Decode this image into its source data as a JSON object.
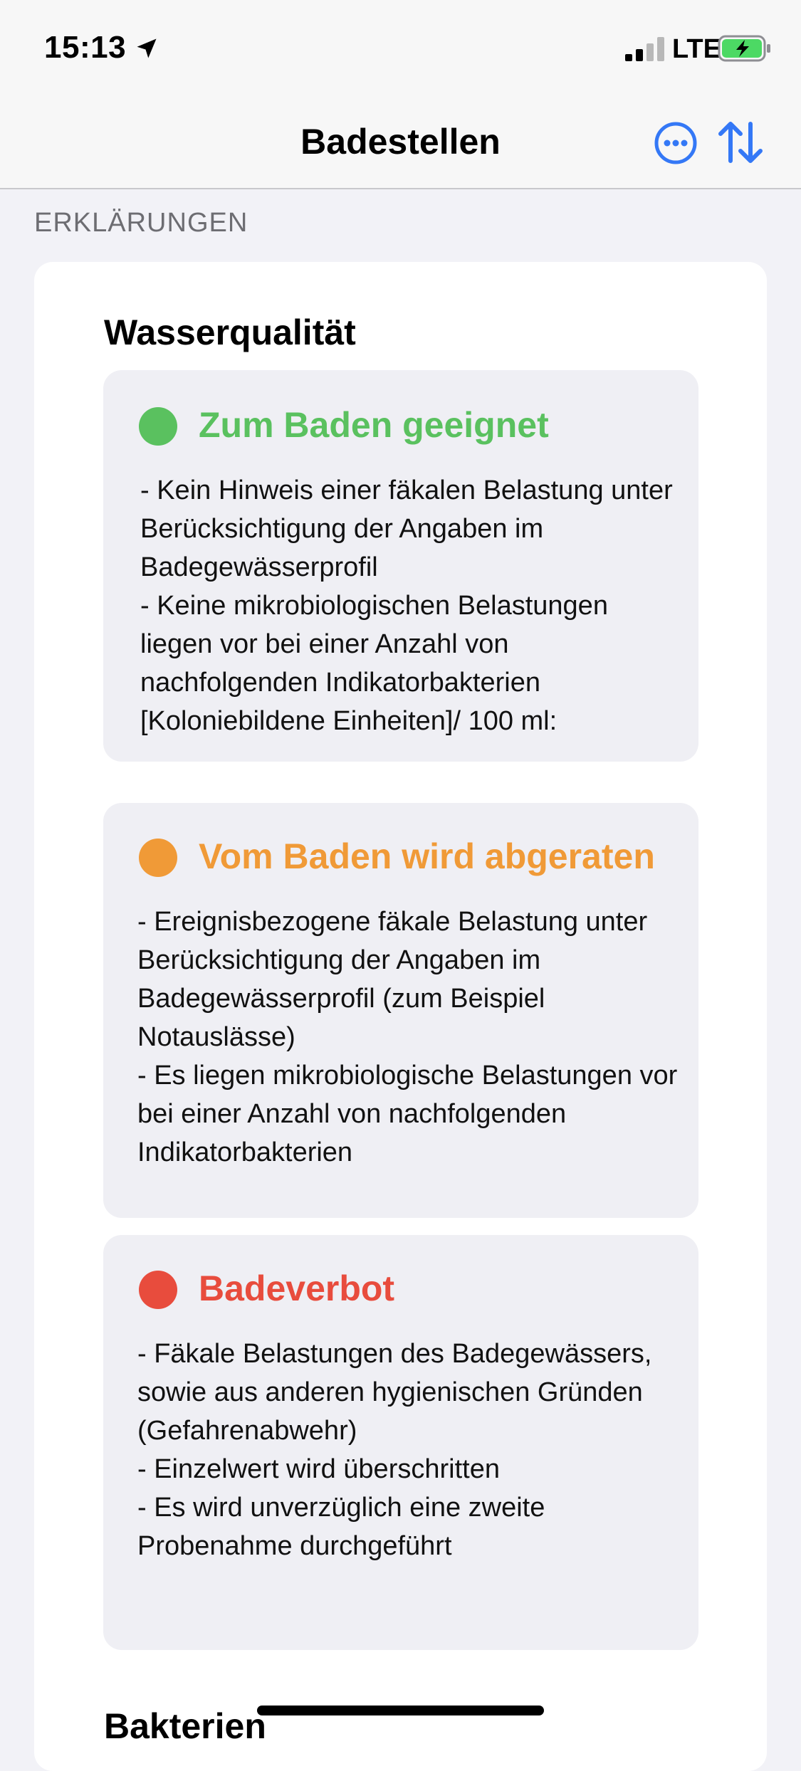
{
  "status_bar": {
    "time": "15:13",
    "network": "LTE",
    "icons": [
      "location-arrow-icon",
      "cellular-signal-icon",
      "battery-charging-icon"
    ]
  },
  "nav": {
    "title": "Badestellen",
    "more_icon": "ellipsis-circle-icon",
    "sort_icon": "sort-arrows-icon"
  },
  "section_header": "ERKLÄRUNGEN",
  "water_quality": {
    "title": "Wasserqualität",
    "items": [
      {
        "title": "Zum Baden geeignet",
        "color": "#5ac15f",
        "text": "- Kein Hinweis einer fäkalen Belastung unter Berücksichtigung der Angaben im Badegewässerprofil\n- Keine mikrobiologischen Belastungen liegen vor bei einer Anzahl von nachfolgenden Indikatorbakterien [Koloniebildene Einheiten]/ 100 ml:"
      },
      {
        "title": "Vom Baden wird abgeraten",
        "color": "#f09a37",
        "text": "- Ereignisbezogene fäkale Belastung unter Berücksichtigung der Angaben im Badegewässerprofil (zum Beispiel Notauslässe)\n- Es liegen mikrobiologische Belastungen vor bei einer Anzahl von nachfolgenden Indikatorbakterien"
      },
      {
        "title": "Badeverbot",
        "color": "#e84c3d",
        "text": "- Fäkale Belastungen des Badegewässers, sowie aus anderen hygienischen Gründen (Gefahrenabwehr)\n- Einzelwert wird überschritten\n- Es wird unverzüglich eine zweite Probenahme durchgeführt"
      }
    ]
  },
  "bacteria": {
    "title": "Bakterien"
  },
  "colors": {
    "accent": "#3478f6",
    "background": "#f2f2f7",
    "card": "#ffffff",
    "inner_box": "#efeff4",
    "battery_green": "#4cd964"
  }
}
